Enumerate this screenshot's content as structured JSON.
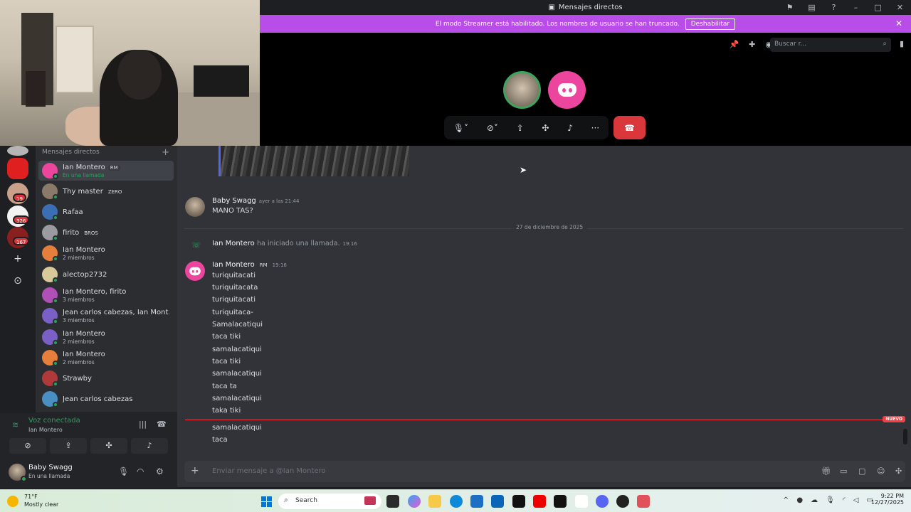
{
  "window": {
    "title": "Mensajes directos"
  },
  "banner": {
    "text": "El modo Streamer está habilitado. Los nombres de usuario se han truncado.",
    "button": "Deshabilitar"
  },
  "call": {
    "search_placeholder": "Buscar r..."
  },
  "rail": {
    "badges": [
      "19",
      "326",
      "167"
    ]
  },
  "dms": {
    "header": "Mensajes directos",
    "items": [
      {
        "name": "Ian Montero",
        "tag": "RM",
        "sub": "En una llamada",
        "color": "#eb459e"
      },
      {
        "name": "Thy master",
        "tag": "ZERO",
        "sub": "",
        "color": "#8a7a6a"
      },
      {
        "name": "Rafaa",
        "tag": "",
        "sub": "",
        "color": "#3a6fb5"
      },
      {
        "name": "firito",
        "tag": "BROS",
        "sub": "",
        "color": "#9a9aa0"
      },
      {
        "name": "Ian Montero",
        "tag": "",
        "sub": "2 miembros",
        "color": "#e67e3c"
      },
      {
        "name": "alectop2732",
        "tag": "",
        "sub": "",
        "color": "#d8c89a"
      },
      {
        "name": "Ian Montero, firito",
        "tag": "",
        "sub": "3 miembros",
        "color": "#b04fb5"
      },
      {
        "name": "Jean carlos cabezas, Ian Mont...",
        "tag": "",
        "sub": "3 miembros",
        "color": "#7a5fc7"
      },
      {
        "name": "Ian Montero",
        "tag": "",
        "sub": "2 miembros",
        "color": "#7a5fc7"
      },
      {
        "name": "Ian Montero",
        "tag": "",
        "sub": "2 miembros",
        "color": "#e67e3c"
      },
      {
        "name": "Strawby",
        "tag": "",
        "sub": "",
        "color": "#b03a3a"
      },
      {
        "name": "Jean carlos cabezas",
        "tag": "",
        "sub": "",
        "color": "#4a8fc2"
      }
    ]
  },
  "voice": {
    "status": "Voz conectada",
    "user": "Ian Montero"
  },
  "user": {
    "name": "Baby Swagg",
    "status": "En una llamada"
  },
  "chat": {
    "msg1_author": "Baby Swagg",
    "msg1_time": "ayer a las 21:44",
    "msg1_text": "MANO TAS?",
    "date_divider": "27 de diciembre de 2025",
    "call_author": "Ian Montero",
    "call_text": "ha iniciado una llamada.",
    "call_time": "19:16",
    "msg2_author": "Ian Montero",
    "msg2_tag": "RM",
    "msg2_time": "19:16",
    "lines": [
      "turiquitacati",
      "turiquitacata",
      "turiquitacati",
      "turiquitaca-",
      "Samalacatiqui",
      "taca tiki",
      "samalacatiqui",
      "taca tiki",
      "samalacatiqui",
      "taca ta",
      "samalacatiqui",
      "taka tiki"
    ],
    "new_label": "NUEVO",
    "after_new": [
      "samalacatiqui",
      "taca"
    ],
    "input_placeholder": "Enviar mensaje a @Ian Montero"
  },
  "taskbar": {
    "temp": "71°F",
    "weather": "Mostly clear",
    "search": "Search",
    "time": "9:22 PM",
    "date": "12/27/2025"
  }
}
